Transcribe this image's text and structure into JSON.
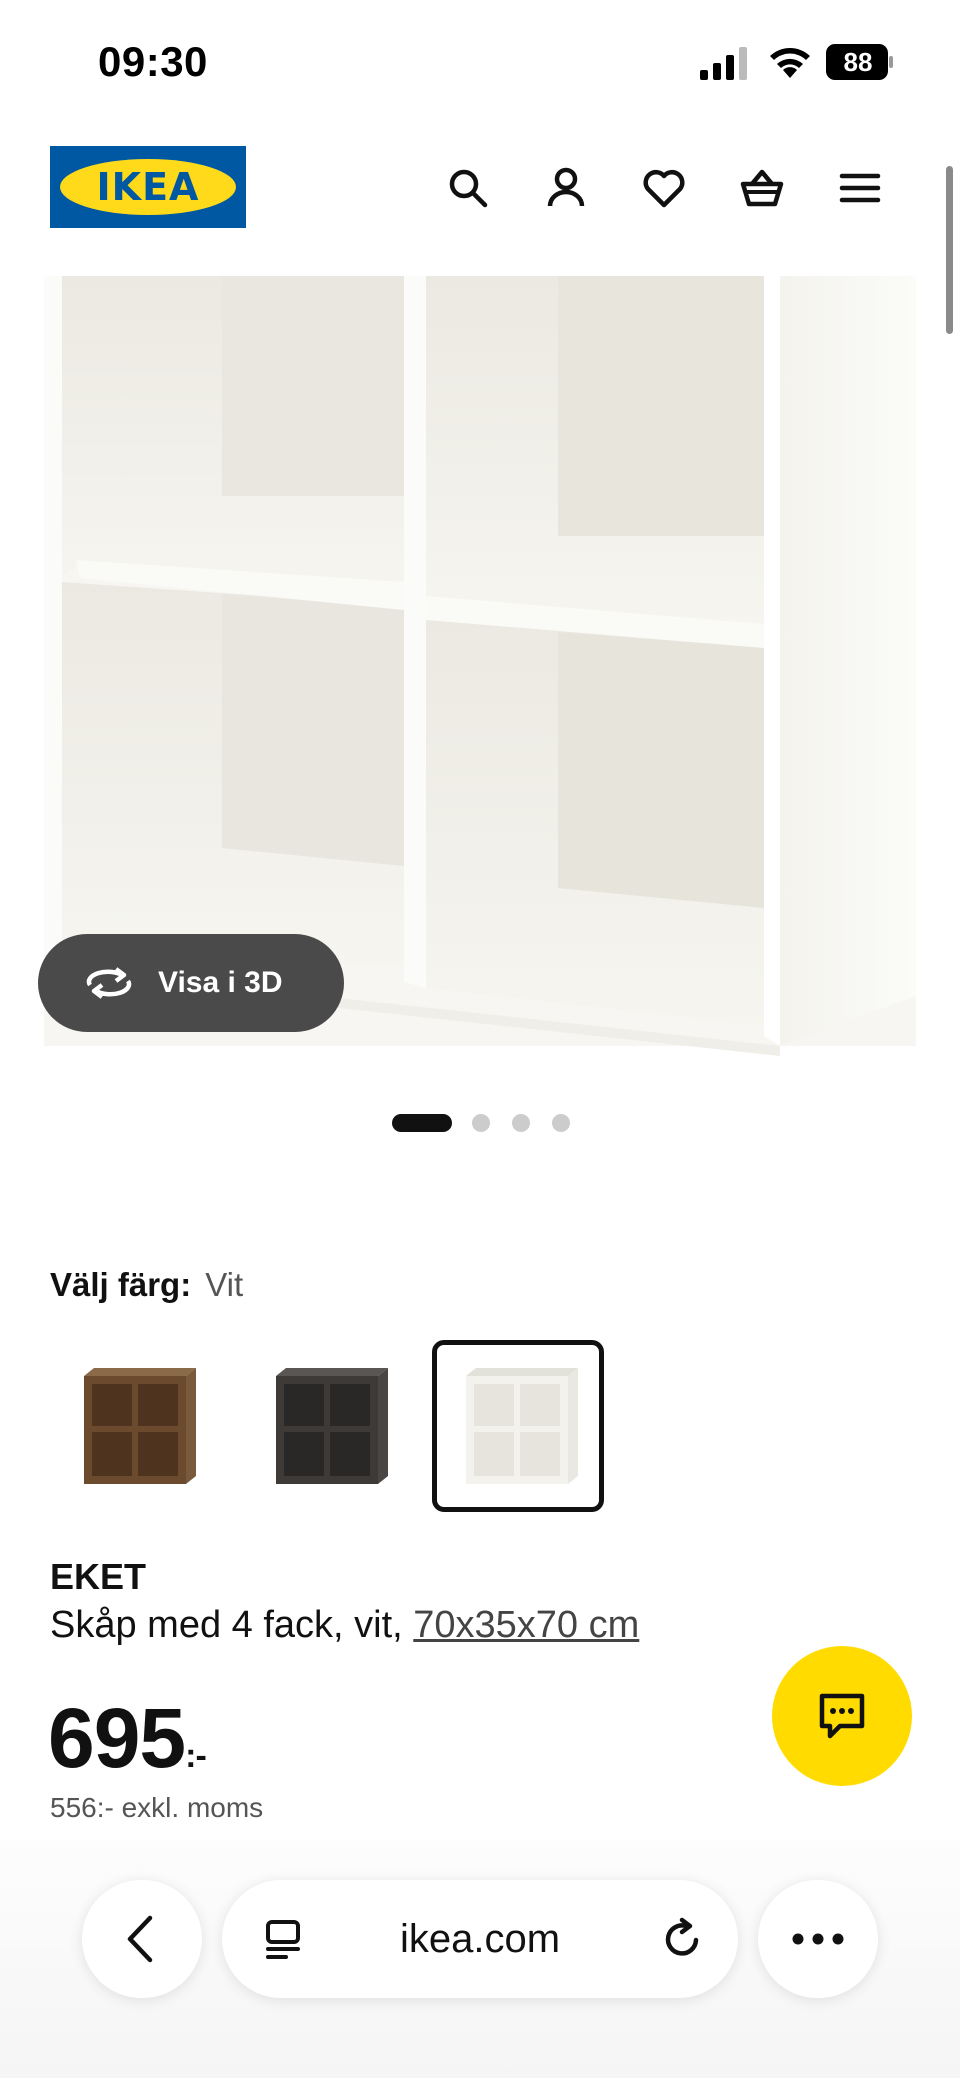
{
  "status": {
    "time": "09:30",
    "battery": "88"
  },
  "header": {
    "logo_text": "IKEA",
    "brand_colors": {
      "blue": "#0058a3",
      "yellow": "#ffda1a"
    }
  },
  "gallery": {
    "view3d_label": "Visa i 3D",
    "slide_count": 4,
    "active_slide": 1
  },
  "color_picker": {
    "label": "Välj färg:",
    "selected": "Vit",
    "options": [
      {
        "name": "valnöt",
        "color": "#6b4a2e",
        "selected": false
      },
      {
        "name": "mörkgrå",
        "color": "#3d3a38",
        "selected": false
      },
      {
        "name": "vit",
        "color": "#f3f2ec",
        "selected": true
      }
    ]
  },
  "product": {
    "name": "EKET",
    "description": "Skåp med 4 fack, vit, ",
    "dimensions": "70x35x70 cm",
    "price": "695",
    "price_suffix": ":-",
    "price_excl": "556:- exkl. moms"
  },
  "browser": {
    "url": "ikea.com"
  }
}
